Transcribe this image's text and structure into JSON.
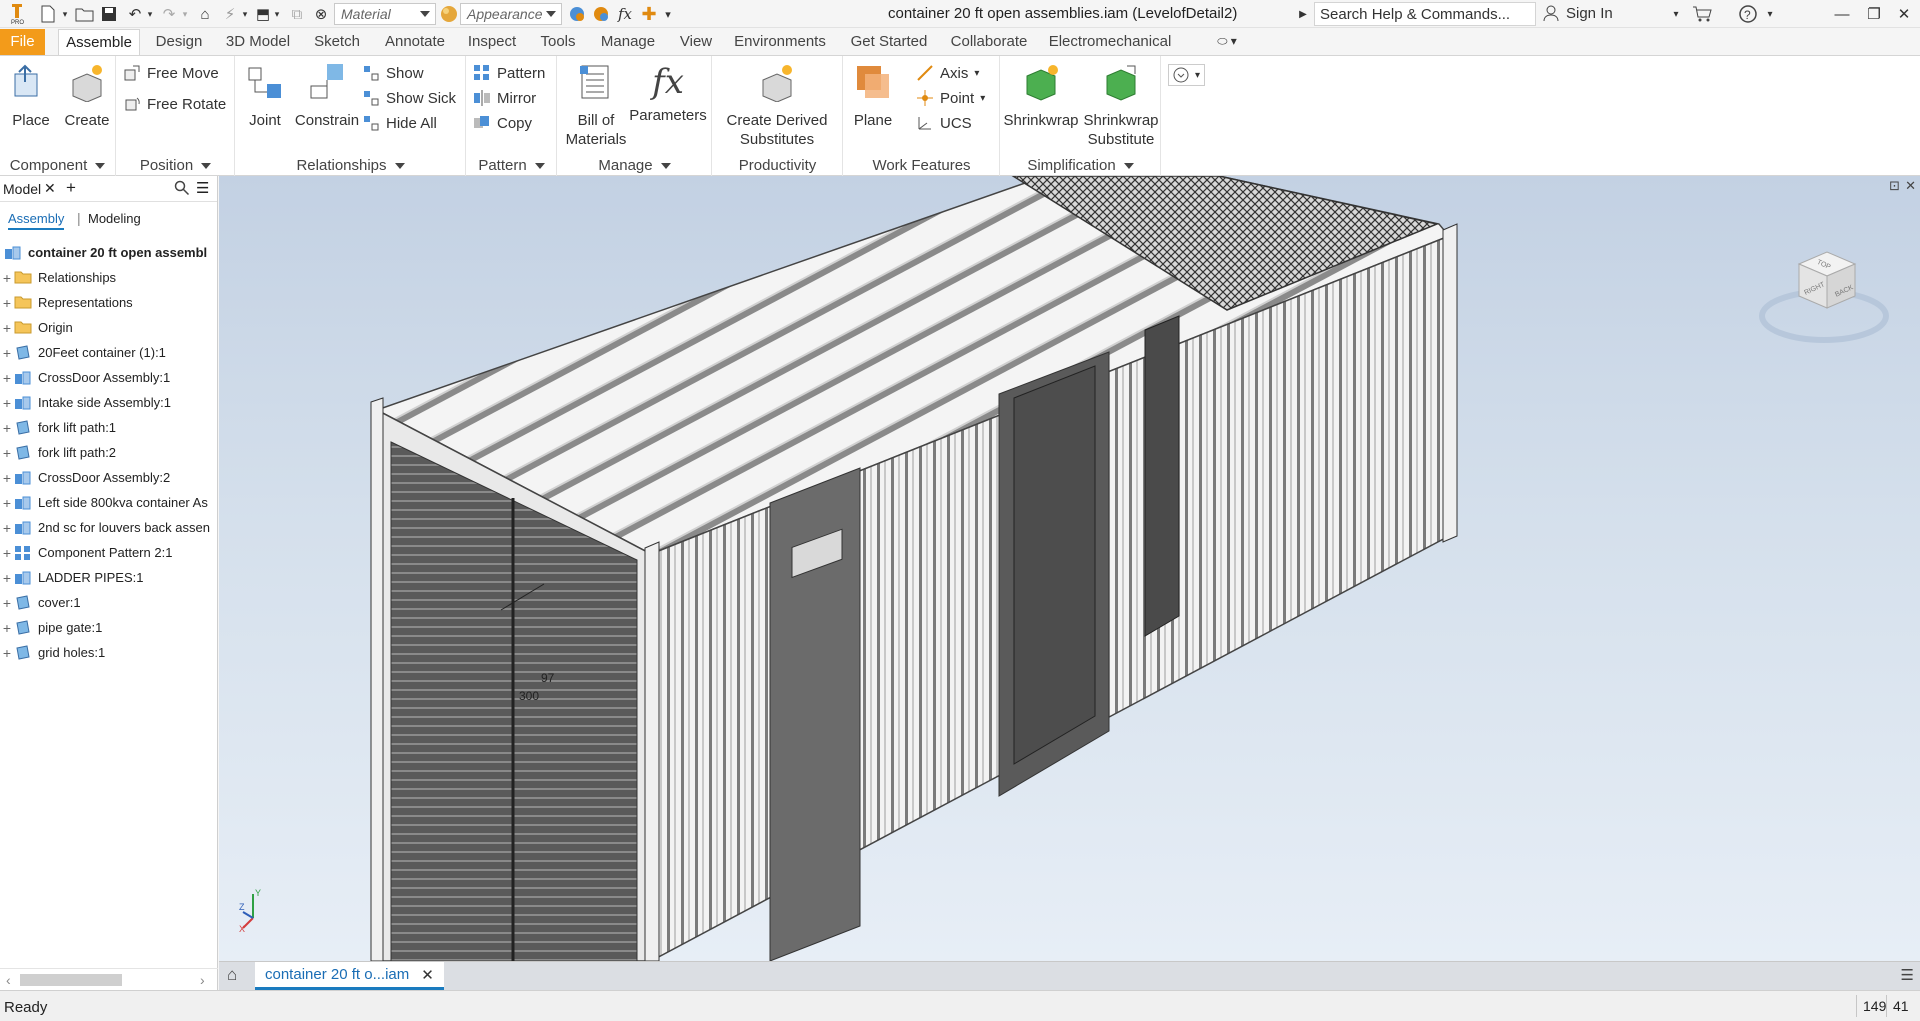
{
  "titlebar": {
    "material_placeholder": "Material",
    "appearance_placeholder": "Appearance",
    "document_title": "container 20 ft open assemblies.iam (LevelofDetail2)",
    "search_placeholder": "Search Help & Commands...",
    "sign_in": "Sign In",
    "fx_label": "fx"
  },
  "tabs": [
    "File",
    "Assemble",
    "Design",
    "3D Model",
    "Sketch",
    "Annotate",
    "Inspect",
    "Tools",
    "Manage",
    "View",
    "Environments",
    "Get Started",
    "Collaborate",
    "Electromechanical"
  ],
  "active_tab": "Assemble",
  "ribbon": {
    "component": {
      "title": "Component",
      "place": "Place",
      "create": "Create"
    },
    "position": {
      "title": "Position",
      "free_move": "Free Move",
      "free_rotate": "Free Rotate"
    },
    "relationships": {
      "title": "Relationships",
      "joint": "Joint",
      "constrain": "Constrain",
      "show": "Show",
      "show_sick": "Show Sick",
      "hide_all": "Hide All"
    },
    "pattern": {
      "title": "Pattern",
      "pattern": "Pattern",
      "mirror": "Mirror",
      "copy": "Copy"
    },
    "manage": {
      "title": "Manage",
      "bom_line1": "Bill of",
      "bom_line2": "Materials",
      "parameters": "Parameters"
    },
    "productivity": {
      "title": "Productivity",
      "cds_line1": "Create Derived",
      "cds_line2": "Substitutes"
    },
    "work_features": {
      "title": "Work Features",
      "plane": "Plane",
      "axis": "Axis",
      "point": "Point",
      "ucs": "UCS"
    },
    "simplification": {
      "title": "Simplification",
      "shrinkwrap": "Shrinkwrap",
      "sws_line1": "Shrinkwrap",
      "sws_line2": "Substitute"
    }
  },
  "browser": {
    "title": "Model",
    "tab_assembly": "Assembly",
    "tab_modeling": "Modeling",
    "root": "container 20 ft open assembl",
    "items": [
      {
        "label": "Relationships",
        "icon": "folder-icon"
      },
      {
        "label": "Representations",
        "icon": "folder-icon"
      },
      {
        "label": "Origin",
        "icon": "folder-icon"
      },
      {
        "label": "20Feet container (1):1",
        "icon": "part-icon"
      },
      {
        "label": "CrossDoor Assembly:1",
        "icon": "assembly-icon"
      },
      {
        "label": "Intake side Assembly:1",
        "icon": "assembly-icon"
      },
      {
        "label": "fork lift path:1",
        "icon": "part-icon"
      },
      {
        "label": "fork lift path:2",
        "icon": "part-icon"
      },
      {
        "label": "CrossDoor Assembly:2",
        "icon": "assembly-icon"
      },
      {
        "label": "Left side 800kva container As",
        "icon": "assembly-icon"
      },
      {
        "label": "2nd sc for louvers back assen",
        "icon": "assembly-icon"
      },
      {
        "label": "Component Pattern 2:1",
        "icon": "pattern-icon"
      },
      {
        "label": "LADDER PIPES:1",
        "icon": "assembly-icon"
      },
      {
        "label": "cover:1",
        "icon": "part-icon"
      },
      {
        "label": "pipe gate:1",
        "icon": "part-icon"
      },
      {
        "label": "grid holes:1",
        "icon": "part-icon"
      }
    ]
  },
  "viewport": {
    "dim_97": "97",
    "dim_300": "300",
    "viewcube_right": "RIGHT",
    "viewcube_back": "BACK",
    "viewcube_top": "TOP",
    "axis_x": "X",
    "axis_y": "Y",
    "axis_z": "Z"
  },
  "doc_tab": "container 20 ft o...iam",
  "status": {
    "text": "Ready",
    "count1": "149",
    "count2": "41"
  },
  "colors": {
    "accent": "#f39b1a",
    "tab_underline": "#1a7bbf"
  }
}
